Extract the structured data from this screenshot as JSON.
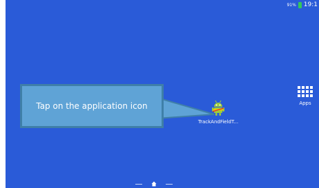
{
  "status_bar": {
    "battery_percent": "91%",
    "time": "19:1"
  },
  "callout": {
    "text": "Tap on the application icon"
  },
  "home_screen": {
    "app": {
      "label": "TrackAndFieldT..."
    },
    "apps_button": {
      "label": "Apps"
    }
  },
  "colors": {
    "wallpaper": "#2a5bd8",
    "callout_fill": "#5fa3d6",
    "callout_border": "#3f7fa8",
    "battery": "#34c759"
  },
  "icons": {
    "app": "android-robot-icon",
    "apps": "apps-grid-icon",
    "home": "home-icon",
    "battery": "battery-icon"
  }
}
